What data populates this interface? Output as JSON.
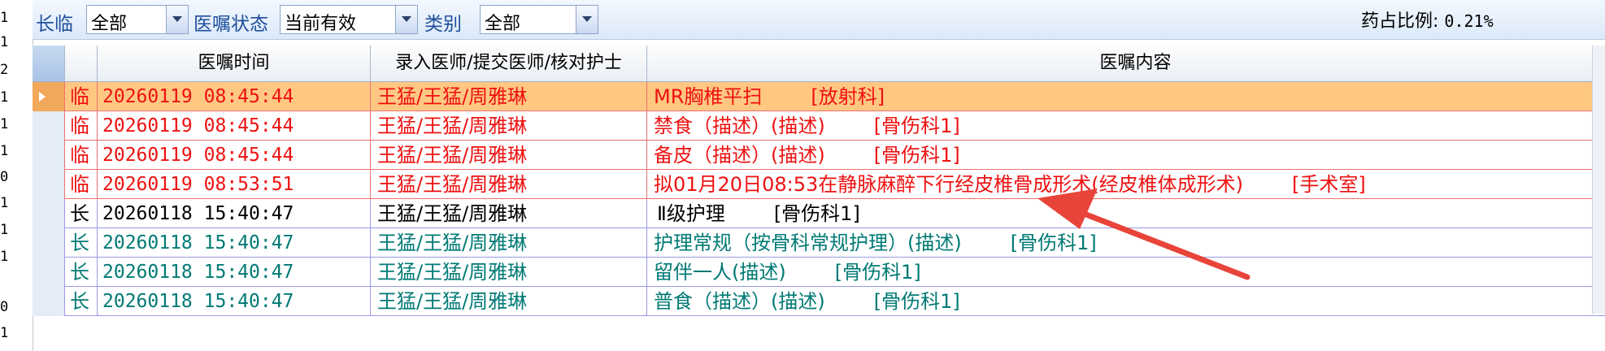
{
  "gutter": [
    "1",
    "1",
    "2",
    "1",
    "1",
    "1",
    "0",
    "1",
    "1",
    "1",
    "0",
    "1"
  ],
  "toolbar": {
    "type_label": "长临",
    "type_value": "全部",
    "status_label": "医嘱状态",
    "status_value": "当前有效",
    "category_label": "类别",
    "category_value": "全部",
    "ratio_label": "药占比例:",
    "ratio_value": "0.21%"
  },
  "columns": [
    "医嘱时间",
    "录入医师/提交医师/核对护士",
    "医嘱内容"
  ],
  "rows": [
    {
      "type": "临",
      "time": "20260119 08:45:44",
      "doctors": "王猛/王猛/周雅琳",
      "content": "MR胸椎平扫",
      "dept": "[放射科]"
    },
    {
      "type": "临",
      "time": "20260119 08:45:44",
      "doctors": "王猛/王猛/周雅琳",
      "content": "禁食（描述）(描述)",
      "dept": "[骨伤科1]"
    },
    {
      "type": "临",
      "time": "20260119 08:45:44",
      "doctors": "王猛/王猛/周雅琳",
      "content": "备皮（描述）(描述)",
      "dept": "[骨伤科1]"
    },
    {
      "type": "临",
      "time": "20260119 08:53:51",
      "doctors": "王猛/王猛/周雅琳",
      "content": "拟01月20日08:53在静脉麻醉下行经皮椎骨成形术(经皮椎体成形术)",
      "dept": "[手术室]"
    },
    {
      "type": "长",
      "time": "20260118 15:40:47",
      "doctors": "王猛/王猛/周雅琳",
      "content": "Ⅱ级护理",
      "dept": "[骨伤科1]"
    },
    {
      "type": "长",
      "time": "20260118 15:40:47",
      "doctors": "王猛/王猛/周雅琳",
      "content": "护理常规（按骨科常规护理）(描述)",
      "dept": "[骨伤科1]"
    },
    {
      "type": "长",
      "time": "20260118 15:40:47",
      "doctors": "王猛/王猛/周雅琳",
      "content": "留伴一人(描述)",
      "dept": "[骨伤科1]"
    },
    {
      "type": "长",
      "time": "20260118 15:40:47",
      "doctors": "王猛/王猛/周雅琳",
      "content": "普食（描述）(描述)",
      "dept": "[骨伤科1]"
    }
  ],
  "colors": {
    "temporary_order": "#ee1111",
    "long_term_black": "#000000",
    "long_term_teal": "#007a74",
    "selected_row": "#ffc882",
    "annotation_arrow": "#e8443a"
  }
}
